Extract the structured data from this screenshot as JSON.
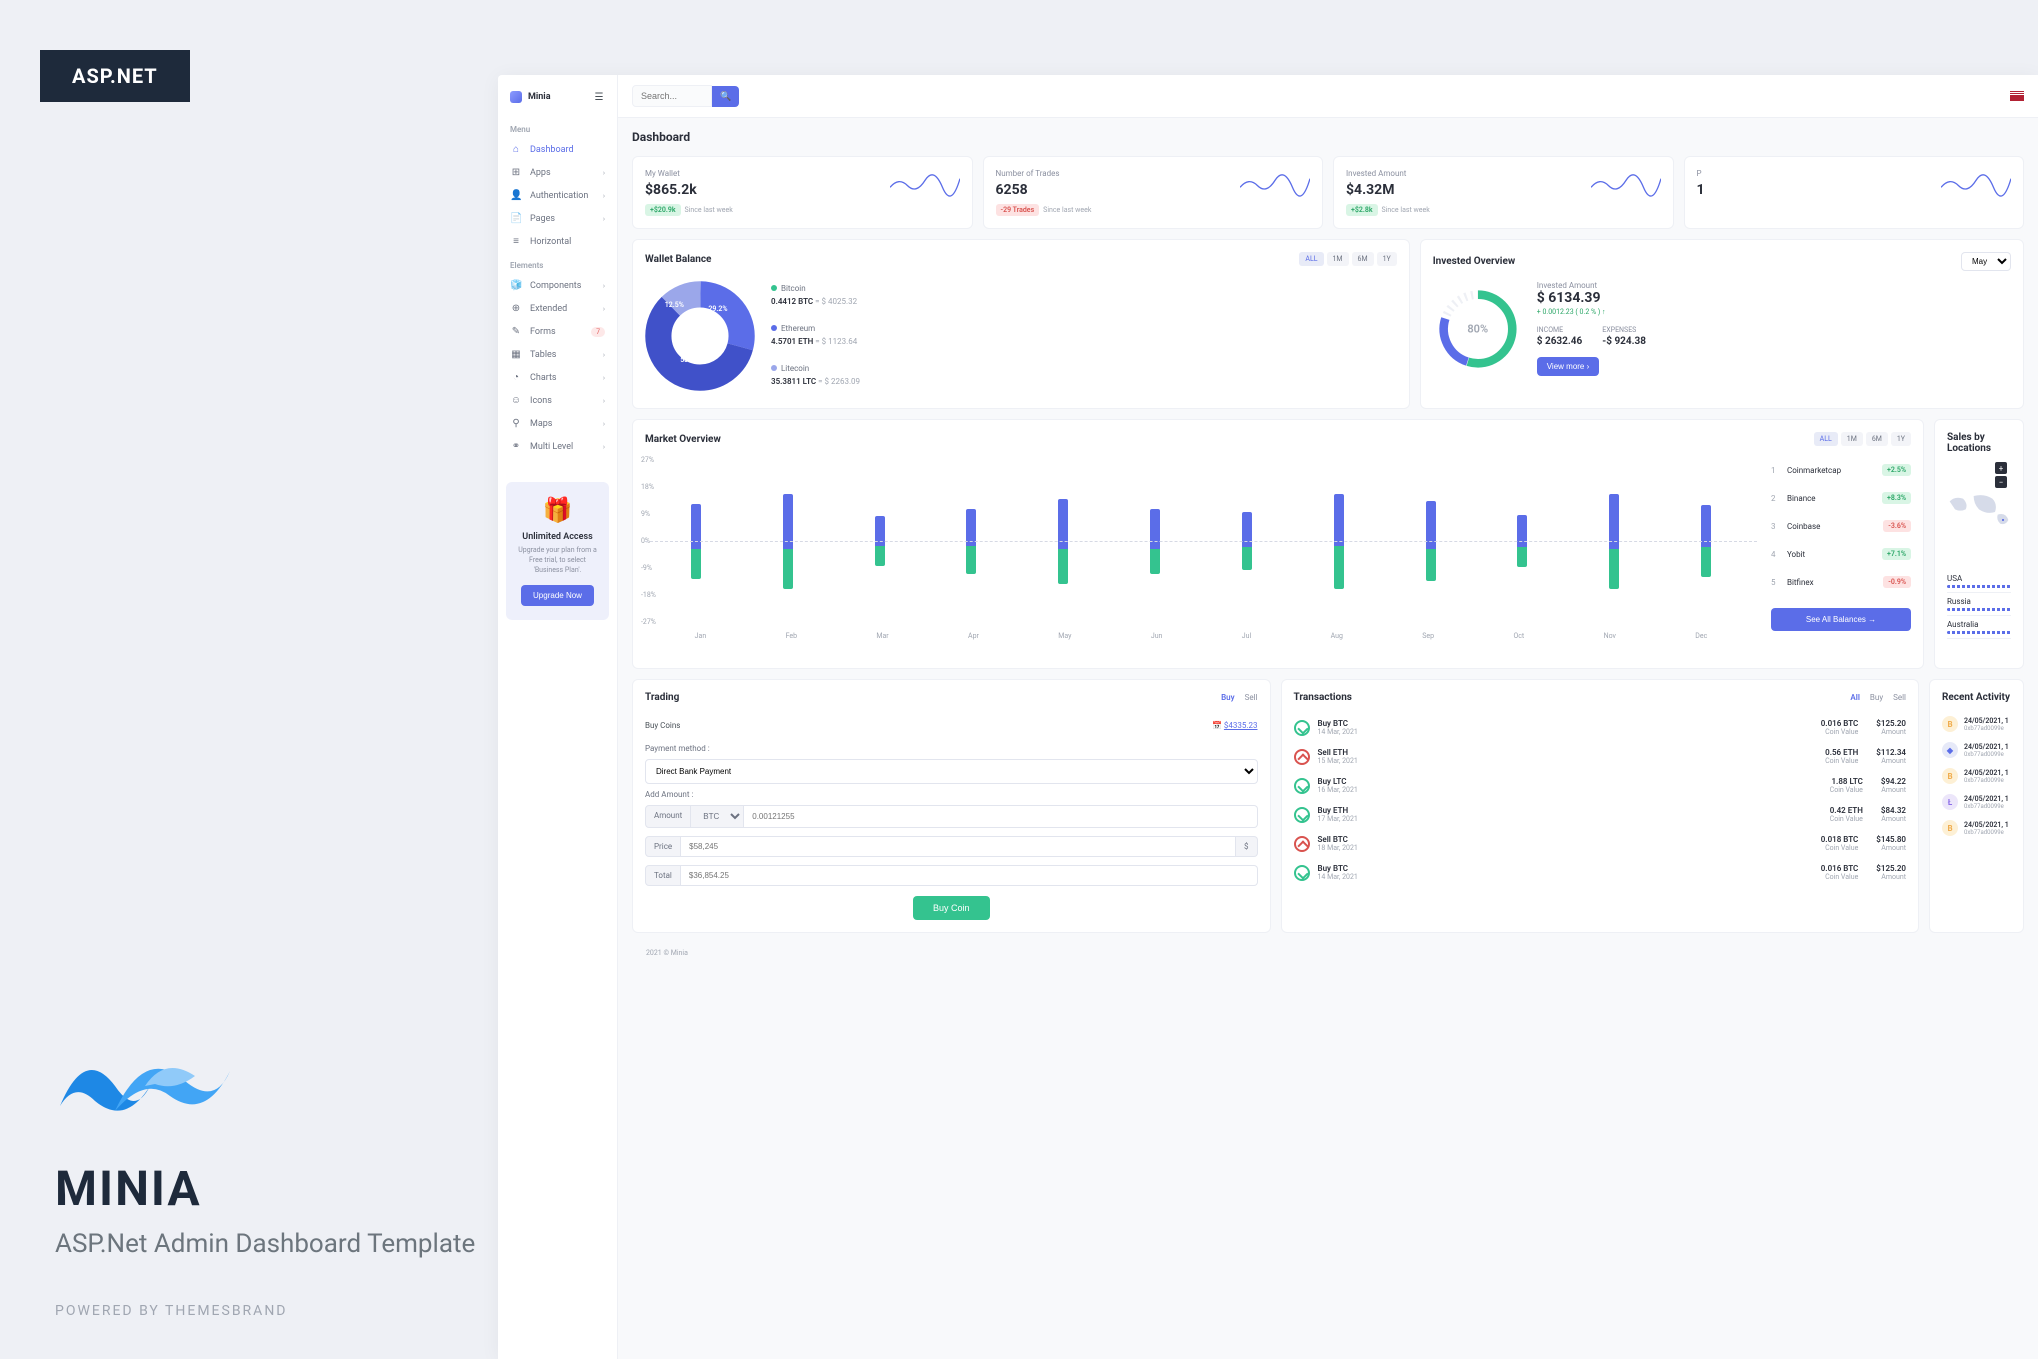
{
  "outer": {
    "tag": "ASP.NET",
    "brand_title": "MINIA",
    "brand_sub": "ASP.Net Admin Dashboard Template",
    "powered": "POWERED BY THEMESBRAND"
  },
  "sidebar": {
    "brand": "Minia",
    "menu_label": "Menu",
    "elements_label": "Elements",
    "items_menu": [
      {
        "label": "Dashboard",
        "icon": "⌂",
        "active": true
      },
      {
        "label": "Apps",
        "icon": "⊞",
        "chev": true
      },
      {
        "label": "Authentication",
        "icon": "👤",
        "chev": true
      },
      {
        "label": "Pages",
        "icon": "📄",
        "chev": true
      },
      {
        "label": "Horizontal",
        "icon": "≡"
      }
    ],
    "items_elements": [
      {
        "label": "Components",
        "icon": "🧊",
        "chev": true
      },
      {
        "label": "Extended",
        "icon": "⊕",
        "chev": true
      },
      {
        "label": "Forms",
        "icon": "✎",
        "badge": "7"
      },
      {
        "label": "Tables",
        "icon": "▦",
        "chev": true
      },
      {
        "label": "Charts",
        "icon": "◔",
        "chev": true
      },
      {
        "label": "Icons",
        "icon": "☺",
        "chev": true
      },
      {
        "label": "Maps",
        "icon": "⚲",
        "chev": true
      },
      {
        "label": "Multi Level",
        "icon": "⚭",
        "chev": true
      }
    ],
    "promo": {
      "title": "Unlimited Access",
      "text": "Upgrade your plan from a Free trial, to select 'Business Plan'.",
      "btn": "Upgrade Now"
    }
  },
  "topbar": {
    "search_placeholder": "Search..."
  },
  "page_title": "Dashboard",
  "stats": [
    {
      "label": "My Wallet",
      "value": "$865.2k",
      "badge": "+$20.9k",
      "badge_class": "g",
      "note": "Since last week"
    },
    {
      "label": "Number of Trades",
      "value": "6258",
      "badge": "-29 Trades",
      "badge_class": "r",
      "note": "Since last week"
    },
    {
      "label": "Invested Amount",
      "value": "$4.32M",
      "badge": "+$2.8k",
      "badge_class": "g",
      "note": "Since last week"
    },
    {
      "label": "P",
      "value": "1"
    }
  ],
  "wallet": {
    "title": "Wallet Balance",
    "ranges": [
      "ALL",
      "1M",
      "6M",
      "1Y"
    ],
    "chart_data": {
      "type": "pie",
      "title": "Wallet Balance",
      "slices": [
        {
          "name": "Bitcoin",
          "pct": 29.2,
          "color": "#5b6de8"
        },
        {
          "name": "Ethereum",
          "pct": 58.3,
          "color": "#4051c9"
        },
        {
          "name": "Litecoin",
          "pct": 12.5,
          "color": "#9ba7ea"
        }
      ]
    },
    "items": [
      {
        "name": "Bitcoin",
        "amount": "0.4412 BTC",
        "usd": "$ 4025.32",
        "color": "#34c38f"
      },
      {
        "name": "Ethereum",
        "amount": "4.5701 ETH",
        "usd": "$ 1123.64",
        "color": "#5b6de8"
      },
      {
        "name": "Litecoin",
        "amount": "35.3811 LTC",
        "usd": "$ 2263.09",
        "color": "#9ba7ea"
      }
    ]
  },
  "invested": {
    "title": "Invested Overview",
    "dropdown": "May",
    "gauge_pct": "80%",
    "label": "Invested Amount",
    "value": "$ 6134.39",
    "delta": "+ 0.0012.23 ( 0.2 % ) ↑",
    "income_label": "INCOME",
    "income": "$ 2632.46",
    "expenses_label": "EXPENSES",
    "expenses": "-$ 924.38",
    "btn": "View more  ›"
  },
  "market": {
    "title": "Market Overview",
    "ranges": [
      "ALL",
      "1M",
      "6M",
      "1Y"
    ],
    "chart_data": {
      "type": "bar",
      "categories": [
        "Jan",
        "Feb",
        "Mar",
        "Apr",
        "May",
        "Jun",
        "Jul",
        "Aug",
        "Sep",
        "Oct",
        "Nov",
        "Dec"
      ],
      "series": [
        {
          "name": "Up",
          "values": [
            18,
            22,
            12,
            15,
            20,
            16,
            14,
            21,
            19,
            13,
            22,
            17
          ]
        },
        {
          "name": "Down",
          "values": [
            -12,
            -16,
            -8,
            -11,
            -14,
            -10,
            -9,
            -17,
            -13,
            -8,
            -16,
            -12
          ]
        }
      ],
      "ylim": [
        -27,
        27
      ],
      "y_ticks": [
        "27%",
        "18%",
        "9%",
        "0%",
        "-9%",
        "-18%",
        "-27%"
      ]
    },
    "balances": [
      {
        "rank": "1",
        "name": "Coinmarketcap",
        "pct": "+2.5%",
        "cls": "g"
      },
      {
        "rank": "2",
        "name": "Binance",
        "pct": "+8.3%",
        "cls": "g"
      },
      {
        "rank": "3",
        "name": "Coinbase",
        "pct": "-3.6%",
        "cls": "r"
      },
      {
        "rank": "4",
        "name": "Yobit",
        "pct": "+7.1%",
        "cls": "g"
      },
      {
        "rank": "5",
        "name": "Bitfinex",
        "pct": "-0.9%",
        "cls": "r"
      }
    ],
    "see_all": "See All Balances  →"
  },
  "locations": {
    "title": "Sales by Locations",
    "items": [
      "USA",
      "Russia",
      "Australia"
    ]
  },
  "trading": {
    "title": "Trading",
    "tabs": [
      "Buy",
      "Sell"
    ],
    "buy_coins_label": "Buy Coins",
    "balance": "$4335.23",
    "payment_label": "Payment method :",
    "payment_option": "Direct Bank Payment",
    "add_amount_label": "Add Amount :",
    "amount_addon": "Amount",
    "currency": "BTC",
    "amount_placeholder": "0.00121255",
    "price_addon": "Price",
    "price_placeholder": "$58,245",
    "price_suffix": "$",
    "total_addon": "Total",
    "total_placeholder": "$36,854.25",
    "btn": "Buy Coin"
  },
  "transactions": {
    "title": "Transactions",
    "tabs": [
      "All",
      "Buy",
      "Sell"
    ],
    "rows": [
      {
        "type": "buy",
        "title": "Buy BTC",
        "date": "14 Mar, 2021",
        "coin": "0.016 BTC",
        "coin_l": "Coin Value",
        "amount": "$125.20",
        "amount_l": "Amount"
      },
      {
        "type": "sell",
        "title": "Sell ETH",
        "date": "15 Mar, 2021",
        "coin": "0.56 ETH",
        "coin_l": "Coin Value",
        "amount": "$112.34",
        "amount_l": "Amount"
      },
      {
        "type": "buy",
        "title": "Buy LTC",
        "date": "16 Mar, 2021",
        "coin": "1.88 LTC",
        "coin_l": "Coin Value",
        "amount": "$94.22",
        "amount_l": "Amount"
      },
      {
        "type": "buy",
        "title": "Buy ETH",
        "date": "17 Mar, 2021",
        "coin": "0.42 ETH",
        "coin_l": "Coin Value",
        "amount": "$84.32",
        "amount_l": "Amount"
      },
      {
        "type": "sell",
        "title": "Sell BTC",
        "date": "18 Mar, 2021",
        "coin": "0.018 BTC",
        "coin_l": "Coin Value",
        "amount": "$145.80",
        "amount_l": "Amount"
      },
      {
        "type": "buy",
        "title": "Buy BTC",
        "date": "14 Mar, 2021",
        "coin": "0.016 BTC",
        "coin_l": "Coin Value",
        "amount": "$125.20",
        "amount_l": "Amount"
      }
    ]
  },
  "activity": {
    "title": "Recent Activity",
    "rows": [
      {
        "icon": "B",
        "cls": "b",
        "date": "24/05/2021, 1",
        "addr": "0xb77ad0099e"
      },
      {
        "icon": "◆",
        "cls": "e",
        "date": "24/05/2021, 1",
        "addr": "0xb77ad0099e"
      },
      {
        "icon": "B",
        "cls": "b",
        "date": "24/05/2021, 1",
        "addr": "0xb77ad0099e"
      },
      {
        "icon": "Ł",
        "cls": "l",
        "date": "24/05/2021, 1",
        "addr": "0xb77ad0099e"
      },
      {
        "icon": "B",
        "cls": "b",
        "date": "24/05/2021, 1",
        "addr": "0xb77ad0099e"
      }
    ]
  },
  "footer": "2021 © Minia"
}
